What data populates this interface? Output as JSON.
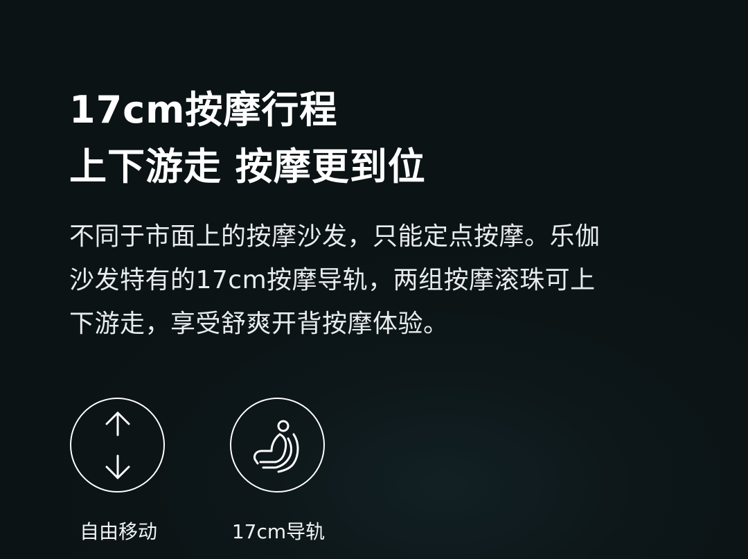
{
  "headline": {
    "line1": "17cm按摩行程",
    "line2": "上下游走 按摩更到位"
  },
  "description": {
    "line1": "不同于市面上的按摩沙发，只能定点按摩。乐伽",
    "line2": "沙发特有的17cm按摩导轨，两组按摩滚珠可上",
    "line3": "下游走，享受舒爽开背按摩体验。"
  },
  "features": [
    {
      "label": "自由移动",
      "icon": "up-down-arrows-icon"
    },
    {
      "label": "17cm导轨",
      "icon": "massage-chair-icon"
    }
  ],
  "colors": {
    "background": "#0c1416",
    "text": "#ffffff"
  }
}
